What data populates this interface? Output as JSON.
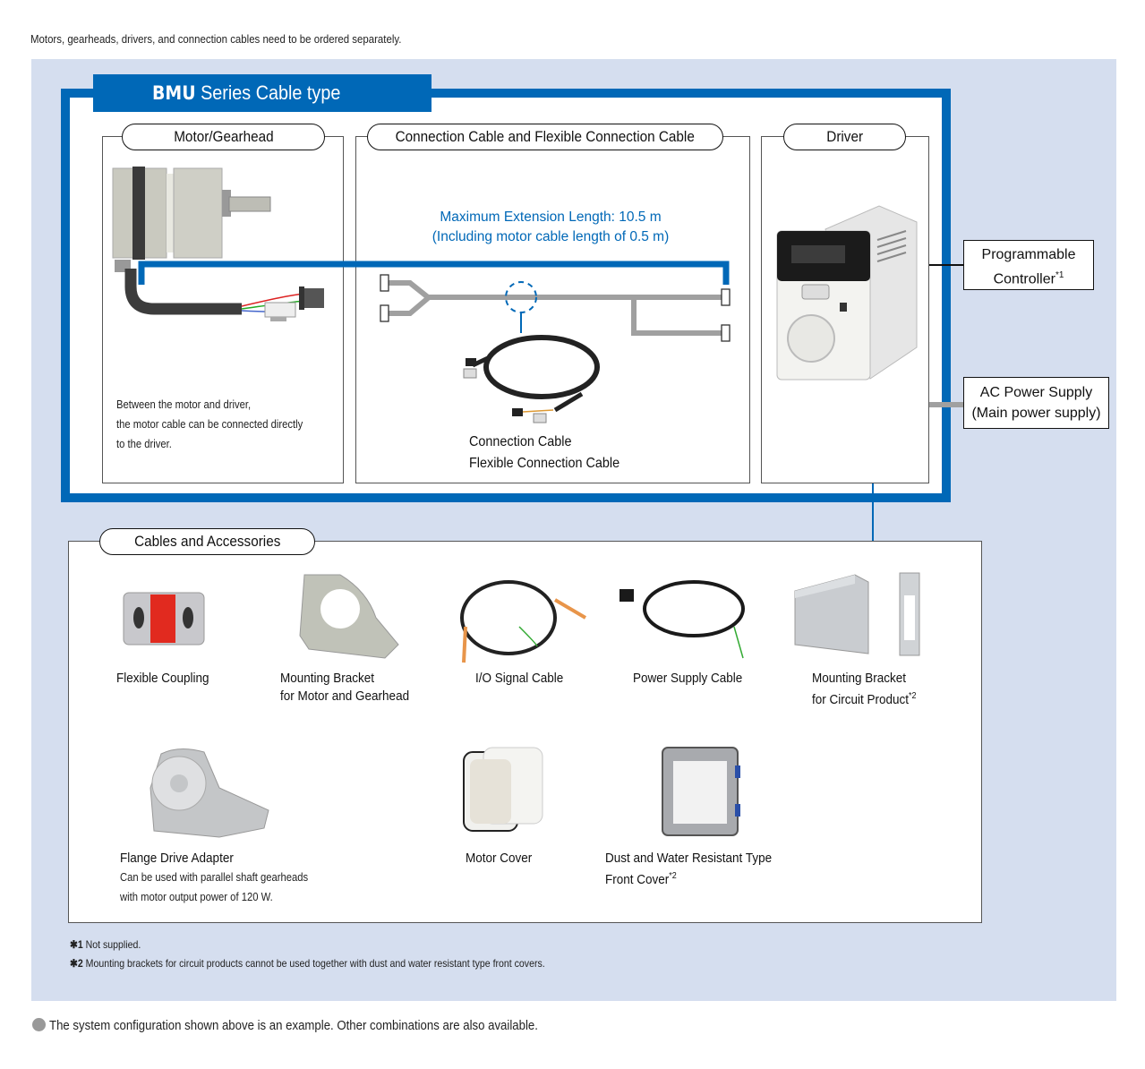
{
  "intro_text": "Motors, gearheads, drivers, and connection cables need to be ordered separately.",
  "series": {
    "name_bold": "BMU",
    "name_rest": " Series  Cable type"
  },
  "sections": {
    "motor": {
      "title": "Motor/Gearhead",
      "note_lines": [
        "Between the motor and driver,",
        "the motor cable can be connected directly",
        "to the driver."
      ]
    },
    "cable": {
      "title": "Connection Cable and Flexible Connection Cable",
      "max_length_line1": "Maximum Extension Length: 10.5 m",
      "max_length_line2": "(Including motor cable length of 0.5 m)",
      "caption_line1": "Connection Cable",
      "caption_line2": "Flexible Connection Cable"
    },
    "driver": {
      "title": "Driver"
    }
  },
  "external": {
    "plc_line1": "Programmable",
    "plc_line2": "Controller",
    "plc_note": "*1",
    "ac_line1": "AC Power Supply",
    "ac_line2": "(Main power supply)"
  },
  "accessories": {
    "title": "Cables and Accessories",
    "items": [
      {
        "label_line1": "Flexible Coupling",
        "label_line2": "",
        "note": "",
        "icon": "flexible-coupling"
      },
      {
        "label_line1": "Mounting Bracket",
        "label_line2": "for Motor and Gearhead",
        "note": "",
        "icon": "motor-mounting-bracket"
      },
      {
        "label_line1": "I/O Signal Cable",
        "label_line2": "",
        "note": "",
        "icon": "io-signal-cable"
      },
      {
        "label_line1": "Power Supply Cable",
        "label_line2": "",
        "note": "",
        "icon": "power-supply-cable"
      },
      {
        "label_line1": "Mounting Bracket",
        "label_line2": "for Circuit Product",
        "note": "*2",
        "icon": "circuit-mounting-bracket"
      },
      {
        "label_line1": "Flange Drive Adapter",
        "label_line2": "",
        "note": "",
        "icon": "flange-drive-adapter",
        "desc_line1": "Can be used with parallel shaft gearheads",
        "desc_line2": "with motor output power of 120 W."
      },
      {
        "label_line1": "Motor Cover",
        "label_line2": "",
        "note": "",
        "icon": "motor-cover"
      },
      {
        "label_line1": "Dust and Water Resistant Type",
        "label_line2": "Front Cover",
        "note": "*2",
        "icon": "front-cover"
      }
    ]
  },
  "footnotes": [
    {
      "mark": "✱1",
      "text": " Not supplied."
    },
    {
      "mark": "✱2",
      "text": " Mounting brackets for circuit products cannot be used together with dust and water resistant type front covers."
    }
  ],
  "bottom_note": "The system configuration shown above is an example. Other combinations are also available.",
  "colors": {
    "brand_blue": "#0068b7",
    "panel_bg": "#d5deef",
    "cable_gray": "#a0a0a0"
  }
}
